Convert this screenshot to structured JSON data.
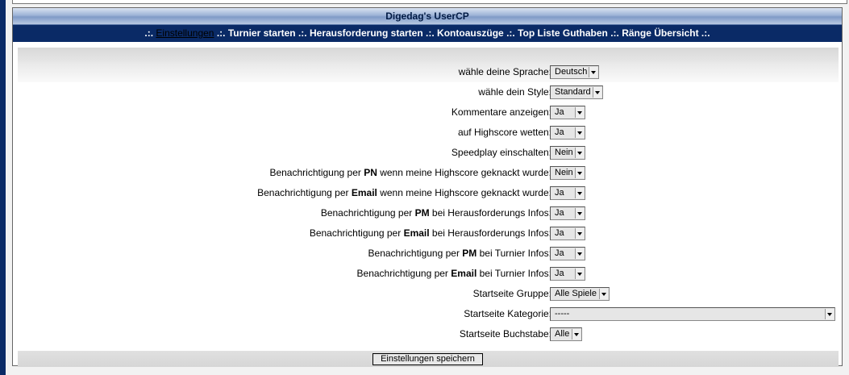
{
  "title": "Digedag's UserCP",
  "nav": {
    "sep": ".:.",
    "items": [
      {
        "label": "Einstellungen",
        "active": true
      },
      {
        "label": "Turnier starten"
      },
      {
        "label": "Herausforderung starten"
      },
      {
        "label": "Kontoauszüge"
      },
      {
        "label": "Top Liste Guthaben"
      },
      {
        "label": "Ränge Übersicht"
      }
    ]
  },
  "settings": [
    {
      "pre": "wähle deine Sprache:",
      "value": "Deutsch"
    },
    {
      "pre": "wähle dein Style:",
      "value": "Standard"
    },
    {
      "pre": "Kommentare anzeigen:",
      "value": "Ja"
    },
    {
      "pre": "auf Highscore wetten:",
      "value": "Ja"
    },
    {
      "pre": "Speedplay einschalten:",
      "value": "Nein"
    },
    {
      "pre": "Benachrichtigung per ",
      "bold": "PN",
      "post": " wenn meine Highscore geknackt wurde:",
      "value": "Nein"
    },
    {
      "pre": "Benachrichtigung per ",
      "bold": "Email",
      "post": " wenn meine Highscore geknackt wurde:",
      "value": "Ja"
    },
    {
      "pre": "Benachrichtigung per ",
      "bold": "PM",
      "post": " bei Herausforderungs Infos:",
      "value": "Ja"
    },
    {
      "pre": "Benachrichtigung per ",
      "bold": "Email",
      "post": " bei Herausforderungs Infos:",
      "value": "Ja"
    },
    {
      "pre": "Benachrichtigung per ",
      "bold": "PM",
      "post": " bei Turnier Infos:",
      "value": "Ja"
    },
    {
      "pre": "Benachrichtigung per ",
      "bold": "Email",
      "post": " bei Turnier Infos:",
      "value": "Ja"
    },
    {
      "pre": "Startseite Gruppe:",
      "value": "Alle Spiele"
    },
    {
      "pre": "Startseite Kategorie:",
      "value": "-----"
    },
    {
      "pre": "Startseite Buchstabe:",
      "value": "Alle"
    }
  ],
  "save_label": "Einstellungen speichern"
}
